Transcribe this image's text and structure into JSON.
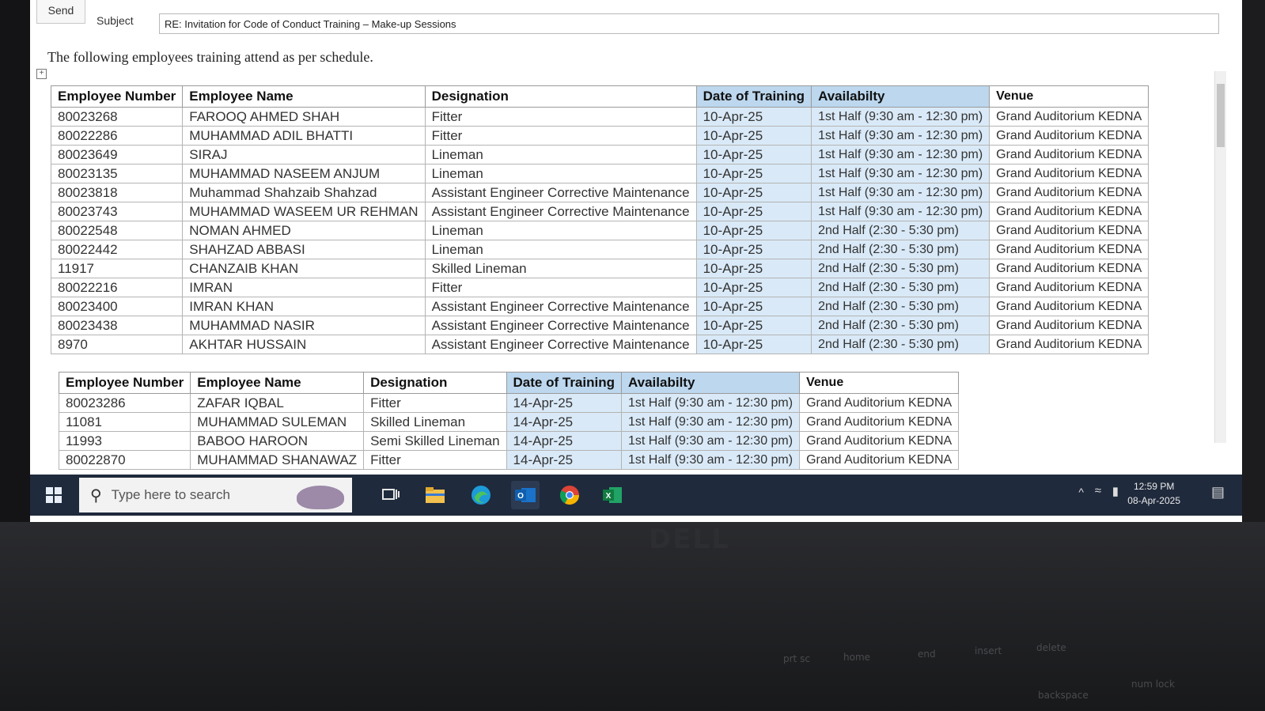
{
  "email": {
    "send_label": "Send",
    "subject_label": "Subject",
    "subject_value": "RE: Invitation for Code of Conduct Training – Make-up Sessions",
    "body_intro": "The following employees training attend as per schedule."
  },
  "columns": {
    "employee_number": "Employee Number",
    "employee_name": "Employee Name",
    "designation": "Designation",
    "date": "Date of Training",
    "availability": "Availabilty",
    "venue": "Venue"
  },
  "table1": [
    {
      "num": "80023268",
      "name": "FAROOQ AHMED SHAH",
      "designation": "Fitter",
      "date": "10-Apr-25",
      "availability": "1st Half (9:30 am - 12:30 pm)",
      "venue": "Grand Auditorium KEDNA"
    },
    {
      "num": "80022286",
      "name": "MUHAMMAD ADIL BHATTI",
      "designation": "Fitter",
      "date": "10-Apr-25",
      "availability": "1st Half (9:30 am - 12:30 pm)",
      "venue": "Grand Auditorium KEDNA"
    },
    {
      "num": "80023649",
      "name": "SIRAJ",
      "designation": "Lineman",
      "date": "10-Apr-25",
      "availability": "1st Half (9:30 am - 12:30 pm)",
      "venue": "Grand Auditorium KEDNA"
    },
    {
      "num": "80023135",
      "name": "MUHAMMAD NASEEM ANJUM",
      "designation": "Lineman",
      "date": "10-Apr-25",
      "availability": "1st Half (9:30 am - 12:30 pm)",
      "venue": "Grand Auditorium KEDNA"
    },
    {
      "num": "80023818",
      "name": "Muhammad Shahzaib Shahzad",
      "designation": "Assistant Engineer Corrective Maintenance",
      "date": "10-Apr-25",
      "availability": "1st Half (9:30 am - 12:30 pm)",
      "venue": "Grand Auditorium KEDNA"
    },
    {
      "num": "80023743",
      "name": "MUHAMMAD WASEEM UR REHMAN",
      "designation": "Assistant Engineer Corrective Maintenance",
      "date": "10-Apr-25",
      "availability": "1st Half (9:30 am - 12:30 pm)",
      "venue": "Grand Auditorium KEDNA"
    },
    {
      "num": "80022548",
      "name": "NOMAN AHMED",
      "designation": "Lineman",
      "date": "10-Apr-25",
      "availability": "2nd Half (2:30 - 5:30 pm)",
      "venue": "Grand Auditorium KEDNA"
    },
    {
      "num": "80022442",
      "name": "SHAHZAD ABBASI",
      "designation": "Lineman",
      "date": "10-Apr-25",
      "availability": "2nd Half (2:30 - 5:30 pm)",
      "venue": "Grand Auditorium KEDNA"
    },
    {
      "num": "11917",
      "name": "CHANZAIB KHAN",
      "designation": "Skilled Lineman",
      "date": "10-Apr-25",
      "availability": "2nd Half (2:30 - 5:30 pm)",
      "venue": "Grand Auditorium KEDNA"
    },
    {
      "num": "80022216",
      "name": "IMRAN",
      "designation": "Fitter",
      "date": "10-Apr-25",
      "availability": "2nd Half (2:30 - 5:30 pm)",
      "venue": "Grand Auditorium KEDNA"
    },
    {
      "num": "80023400",
      "name": "IMRAN KHAN",
      "designation": "Assistant Engineer Corrective Maintenance",
      "date": "10-Apr-25",
      "availability": "2nd Half (2:30 - 5:30 pm)",
      "venue": "Grand Auditorium KEDNA"
    },
    {
      "num": "80023438",
      "name": "MUHAMMAD NASIR",
      "designation": "Assistant Engineer Corrective Maintenance",
      "date": "10-Apr-25",
      "availability": "2nd Half (2:30 - 5:30 pm)",
      "venue": "Grand Auditorium KEDNA"
    },
    {
      "num": "8970",
      "name": "AKHTAR HUSSAIN",
      "designation": "Assistant Engineer Corrective Maintenance",
      "date": "10-Apr-25",
      "availability": "2nd Half (2:30 - 5:30 pm)",
      "venue": "Grand Auditorium KEDNA"
    }
  ],
  "table2": [
    {
      "num": "80023286",
      "name": "ZAFAR IQBAL",
      "designation": "Fitter",
      "date": "14-Apr-25",
      "availability": "1st Half (9:30 am - 12:30 pm)",
      "venue": "Grand Auditorium KEDNA"
    },
    {
      "num": "11081",
      "name": "MUHAMMAD SULEMAN",
      "designation": "Skilled Lineman",
      "date": "14-Apr-25",
      "availability": "1st Half (9:30 am - 12:30 pm)",
      "venue": "Grand Auditorium KEDNA"
    },
    {
      "num": "11993",
      "name": "BABOO HAROON",
      "designation": "Semi Skilled Lineman",
      "date": "14-Apr-25",
      "availability": "1st Half (9:30 am - 12:30 pm)",
      "venue": "Grand Auditorium KEDNA"
    },
    {
      "num": "80022870",
      "name": "MUHAMMAD SHANAWAZ",
      "designation": "Fitter",
      "date": "14-Apr-25",
      "availability": "1st Half (9:30 am - 12:30 pm)",
      "venue": "Grand Auditorium KEDNA"
    }
  ],
  "taskbar": {
    "search_placeholder": "Type here to search",
    "icons": [
      "windows-icon",
      "task-view-icon",
      "file-explorer-icon",
      "edge-icon",
      "outlook-icon",
      "chrome-icon",
      "excel-icon"
    ],
    "time": "12:59 PM",
    "date": "08-Apr-2025"
  },
  "laptop": {
    "brand": "DELL",
    "keys": [
      "prt sc",
      "home",
      "end",
      "insert",
      "delete",
      "backspace",
      "num lock"
    ]
  },
  "colors": {
    "header_blue": "#bcd7ee",
    "cell_blue": "#d9e9f7",
    "taskbar": "#1f2a3c"
  }
}
